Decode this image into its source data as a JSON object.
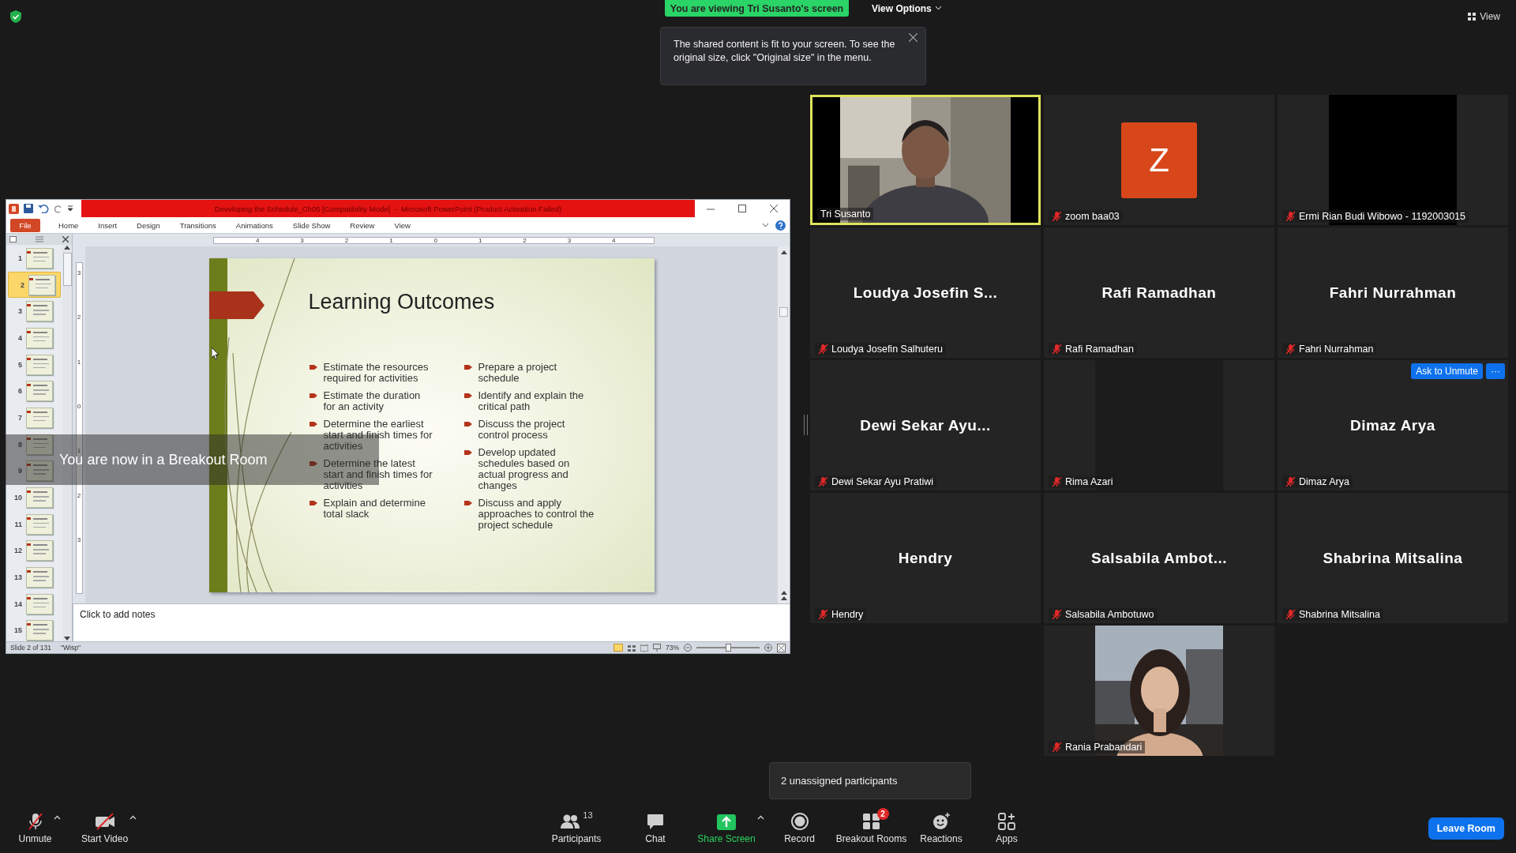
{
  "top_bar": {
    "banner": "You are viewing Tri Susanto's screen",
    "view_options": "View Options",
    "view_button": "View"
  },
  "tooltip": {
    "text": "The shared content is fit to your screen. To see the original size, click \"Original size\" in the menu."
  },
  "ppt": {
    "title": "Developing the Schedule_Ch05 [Compatibility Mode]  -  Microsoft PowerPoint (Product Activation Failed)",
    "tabs": [
      {
        "label": "File",
        "kind": "file"
      },
      {
        "label": "Home",
        "kind": "tab"
      },
      {
        "label": "Insert",
        "kind": "tab"
      },
      {
        "label": "Design",
        "kind": "tab"
      },
      {
        "label": "Transitions",
        "kind": "tab"
      },
      {
        "label": "Animations",
        "kind": "tab"
      },
      {
        "label": "Slide Show",
        "kind": "tab"
      },
      {
        "label": "Review",
        "kind": "tab"
      },
      {
        "label": "View",
        "kind": "tab"
      }
    ],
    "ruler": {
      "horizontal": [
        "4",
        "3",
        "2",
        "1",
        "0",
        "1",
        "2",
        "3",
        "4"
      ],
      "vertical": [
        "3",
        "2",
        "1",
        "0",
        "1",
        "2",
        "3"
      ]
    },
    "slides": [
      {
        "number": "1",
        "selected": false
      },
      {
        "number": "2",
        "selected": true
      },
      {
        "number": "3",
        "selected": false
      },
      {
        "number": "4",
        "selected": false
      },
      {
        "number": "5",
        "selected": false
      },
      {
        "number": "6",
        "selected": false
      },
      {
        "number": "7",
        "selected": false
      },
      {
        "number": "8",
        "selected": false
      },
      {
        "number": "9",
        "selected": false
      },
      {
        "number": "10",
        "selected": false
      },
      {
        "number": "11",
        "selected": false
      },
      {
        "number": "12",
        "selected": false
      },
      {
        "number": "13",
        "selected": false
      },
      {
        "number": "14",
        "selected": false
      },
      {
        "number": "15",
        "selected": false
      }
    ],
    "slide": {
      "title": "Learning Outcomes",
      "left_bullets": [
        "Estimate the resources required for activities",
        "Estimate the duration for an activity",
        "Determine the earliest start and finish times for activities",
        "Determine the latest start and finish times for activities",
        "Explain and determine total slack"
      ],
      "right_bullets": [
        "Prepare a project schedule",
        "Identify and explain the critical path",
        "Discuss the project control process",
        "Develop updated schedules based on actual progress and changes",
        "Discuss and apply approaches to control the project schedule"
      ]
    },
    "notes_placeholder": "Click to add notes",
    "status_bar": {
      "slide_info": "Slide 2 of 131",
      "theme": "\"Wisp\"",
      "zoom": "73%",
      "zoom_slider": {
        "level": 0.5
      }
    }
  },
  "breakout_notice": "You are now in a Breakout Room",
  "gallery": {
    "tiles": [
      {
        "kind": "video",
        "name": "Tri Susanto",
        "speaking": true,
        "muted": false
      },
      {
        "kind": "avatar",
        "initial": "Z",
        "name": "zoom baa03",
        "speaking": false,
        "muted": true
      },
      {
        "kind": "video_off",
        "name": "Ermi Rian Budi Wibowo - 1192003015",
        "speaking": false,
        "muted": true
      },
      {
        "kind": "name",
        "display_name": "Loudya Josefin S...",
        "name": "Loudya Josefin Salhuteru",
        "speaking": false,
        "muted": true
      },
      {
        "kind": "name",
        "display_name": "Rafi Ramadhan",
        "name": "Rafi Ramadhan",
        "speaking": false,
        "muted": true
      },
      {
        "kind": "name",
        "display_name": "Fahri Nurrahman",
        "name": "Fahri Nurrahman",
        "speaking": false,
        "muted": true
      },
      {
        "kind": "name",
        "display_name": "Dewi Sekar Ayu...",
        "name": "Dewi Sekar Ayu Pratiwi",
        "speaking": false,
        "muted": true
      },
      {
        "kind": "blank",
        "name": "Rima Azari",
        "speaking": false,
        "muted": true
      },
      {
        "kind": "name",
        "display_name": "Dimaz Arya",
        "name": "Dimaz Arya",
        "speaking": false,
        "muted": true,
        "ask_button": "Ask to Unmute",
        "more_button": "···"
      },
      {
        "kind": "name",
        "display_name": "Hendry",
        "name": "Hendry",
        "speaking": false,
        "muted": true
      },
      {
        "kind": "name",
        "display_name": "Salsabila  Ambot...",
        "name": "Salsabila Ambotuwo",
        "speaking": false,
        "muted": true
      },
      {
        "kind": "name",
        "display_name": "Shabrina Mitsalina",
        "name": "Shabrina Mitsalina",
        "speaking": false,
        "muted": true
      },
      {
        "kind": "empty"
      },
      {
        "kind": "video2",
        "name": "Rania Prabandari",
        "speaking": false,
        "muted": true
      }
    ]
  },
  "unassigned_popup": "2 unassigned participants",
  "toolbar": {
    "left": [
      {
        "kind": "mic",
        "label": "Unmute",
        "caret": true
      },
      {
        "kind": "camera",
        "label": "Start Video",
        "caret": true
      }
    ],
    "center": [
      {
        "kind": "participants",
        "label": "Participants",
        "count": "13"
      },
      {
        "kind": "chat",
        "label": "Chat"
      },
      {
        "kind": "share",
        "label": "Share Screen",
        "caret": true
      },
      {
        "kind": "record",
        "label": "Record"
      },
      {
        "kind": "breakout",
        "label": "Breakout Rooms",
        "badge": "2"
      },
      {
        "kind": "reactions",
        "label": "Reactions"
      },
      {
        "kind": "apps",
        "label": "Apps"
      }
    ],
    "leave": "Leave Room"
  }
}
